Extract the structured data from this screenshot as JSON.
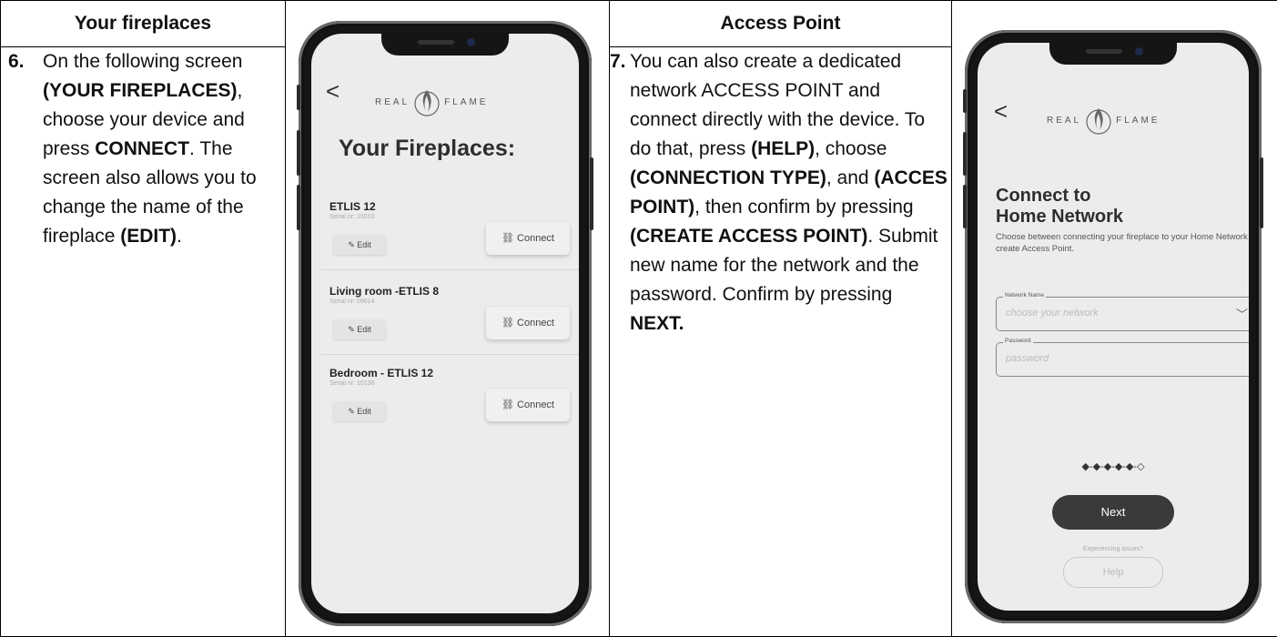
{
  "col1": {
    "header": "Your fireplaces",
    "step_num": "6.",
    "text": [
      {
        "t": "On the following screen ",
        "b": false
      },
      {
        "t": "(YOUR FIREPLACES)",
        "b": true
      },
      {
        "t": ", choose your device and press ",
        "b": false
      },
      {
        "t": "CONNECT",
        "b": true
      },
      {
        "t": ". The screen also allows you to change the name of the fireplace ",
        "b": false
      },
      {
        "t": "(EDIT)",
        "b": true
      },
      {
        "t": ".",
        "b": false
      }
    ]
  },
  "col3": {
    "header": "Access Point",
    "step_num": "7.",
    "text": [
      {
        "t": " You can also create a dedicated network ACCESS POINT and connect directly with the device. To do that, press ",
        "b": false
      },
      {
        "t": "(HELP)",
        "b": true
      },
      {
        "t": ", choose ",
        "b": false
      },
      {
        "t": "(CONNECTION TYPE)",
        "b": true
      },
      {
        "t": ", and ",
        "b": false
      },
      {
        "t": "(ACCES POINT)",
        "b": true
      },
      {
        "t": ", then confirm by pressing ",
        "b": false
      },
      {
        "t": "(CREATE ACCESS POINT)",
        "b": true
      },
      {
        "t": ". Submit new name for the network and the password. Confirm by pressing ",
        "b": false
      },
      {
        "t": "NEXT.",
        "b": true
      }
    ]
  },
  "phone1": {
    "back": "<",
    "logo_left": "REAL",
    "logo_right": "FLAME",
    "title": "Your Fireplaces:",
    "edit_icon": "pencil-icon",
    "connect_icon": "link-icon",
    "devices": [
      {
        "name": "ETLIS 12",
        "serial": "Serial nr: 10010",
        "edit": "Edit",
        "connect": "Connect"
      },
      {
        "name": "Living room -ETLIS 8",
        "serial": "Serial nr: 09614",
        "edit": "Edit",
        "connect": "Connect"
      },
      {
        "name": "Bedroom - ETLIS 12",
        "serial": "Serial nr: 10138",
        "edit": "Edit",
        "connect": "Connect"
      }
    ]
  },
  "phone2": {
    "back": "<",
    "logo_left": "REAL",
    "logo_right": "FLAME",
    "title_line1": "Connect to",
    "title_line2": "Home Network",
    "description": "Choose between connecting your fireplace to your Home Network or create Access Point.",
    "network_label": "Network Name",
    "network_placeholder": "choose your network",
    "password_label": "Password",
    "password_placeholder": "password",
    "progress": "◆-◆-◆-◆-◆-◇",
    "next": "Next",
    "issues": "Experiencing issues?",
    "help": "Help"
  },
  "colors": {
    "button_dark": "#3a3a3a",
    "screen_bg": "#ececec"
  }
}
